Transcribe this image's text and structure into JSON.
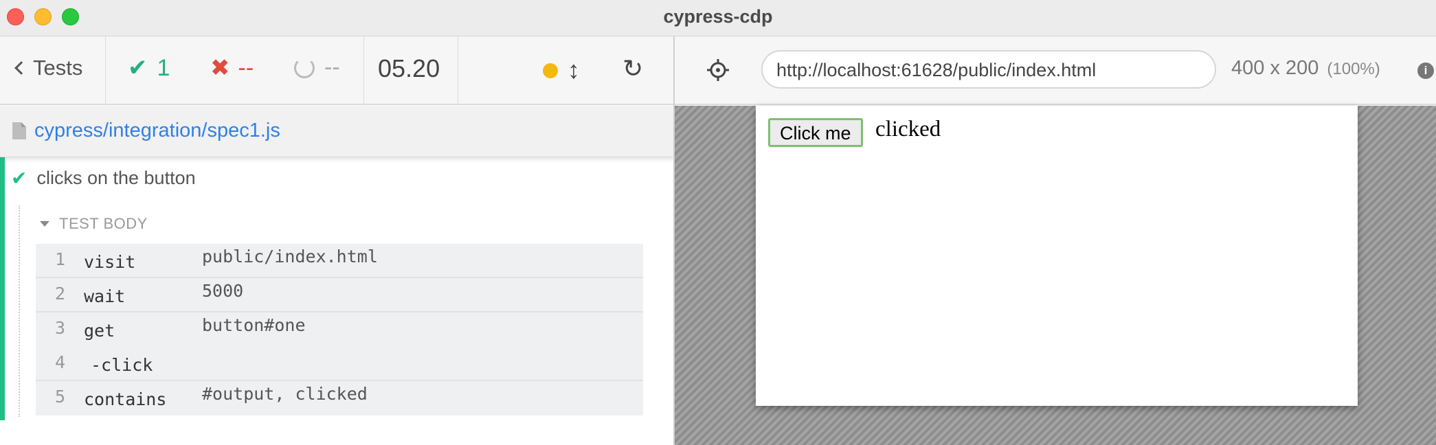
{
  "window": {
    "title": "cypress-cdp"
  },
  "reporter": {
    "back_label": "Tests",
    "stats": {
      "passed": "1",
      "failed": "--",
      "pending": "--",
      "duration": "05.20"
    },
    "spec_file": "cypress/integration/spec1.js",
    "test": {
      "title": "clicks on the button",
      "hook_label": "TEST BODY",
      "commands": [
        {
          "num": "1",
          "name": "visit",
          "message": "public/index.html"
        },
        {
          "num": "2",
          "name": "wait",
          "message": "5000"
        },
        {
          "num": "3",
          "name": "get",
          "message": "button#one"
        },
        {
          "num": "4",
          "name": "-click",
          "message": ""
        },
        {
          "num": "5",
          "name": "contains",
          "message": "#output, clicked"
        }
      ]
    }
  },
  "aut": {
    "url": "http://localhost:61628/public/index.html",
    "viewport_size": "400 x 200",
    "viewport_scale": "(100%)",
    "info_icon": "i",
    "app": {
      "button_label": "Click me",
      "output_text": "clicked"
    }
  },
  "colors": {
    "passed": "#22b07d",
    "failed": "#e34a3c",
    "link": "#2f80e8",
    "running_dot": "#f5b80f"
  }
}
